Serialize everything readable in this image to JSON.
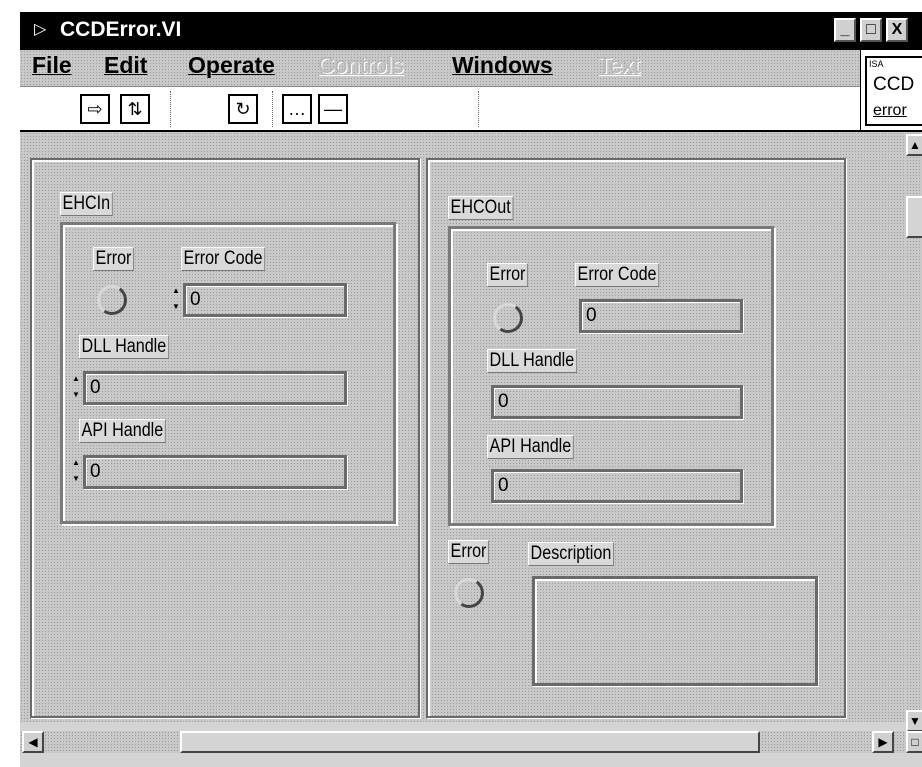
{
  "window": {
    "title": "CCDError.VI",
    "buttons": [
      "_",
      "□",
      "X"
    ]
  },
  "menu": [
    {
      "label": "File",
      "enabled": true
    },
    {
      "label": "Edit",
      "enabled": true
    },
    {
      "label": "Operate",
      "enabled": true
    },
    {
      "label": "Controls",
      "enabled": false
    },
    {
      "label": "Windows",
      "enabled": true
    },
    {
      "label": "Text",
      "enabled": false
    }
  ],
  "vi_icon": {
    "small": "ISA",
    "line1": "CCD",
    "line2": "error"
  },
  "left_cluster": {
    "title": "EHCIn",
    "error_label": "Error",
    "error_code_label": "Error Code",
    "error_code_value": "0",
    "dll_label": "DLL Handle",
    "dll_value": "0",
    "api_label": "API Handle",
    "api_value": "0"
  },
  "right_cluster": {
    "title": "EHCOut",
    "error_label": "Error",
    "error_code_label": "Error Code",
    "error_code_value": "0",
    "dll_label": "DLL Handle",
    "dll_value": "0",
    "api_label": "API Handle",
    "api_value": "0"
  },
  "outputs": {
    "error_label": "Error",
    "description_label": "Description",
    "description_value": ""
  }
}
